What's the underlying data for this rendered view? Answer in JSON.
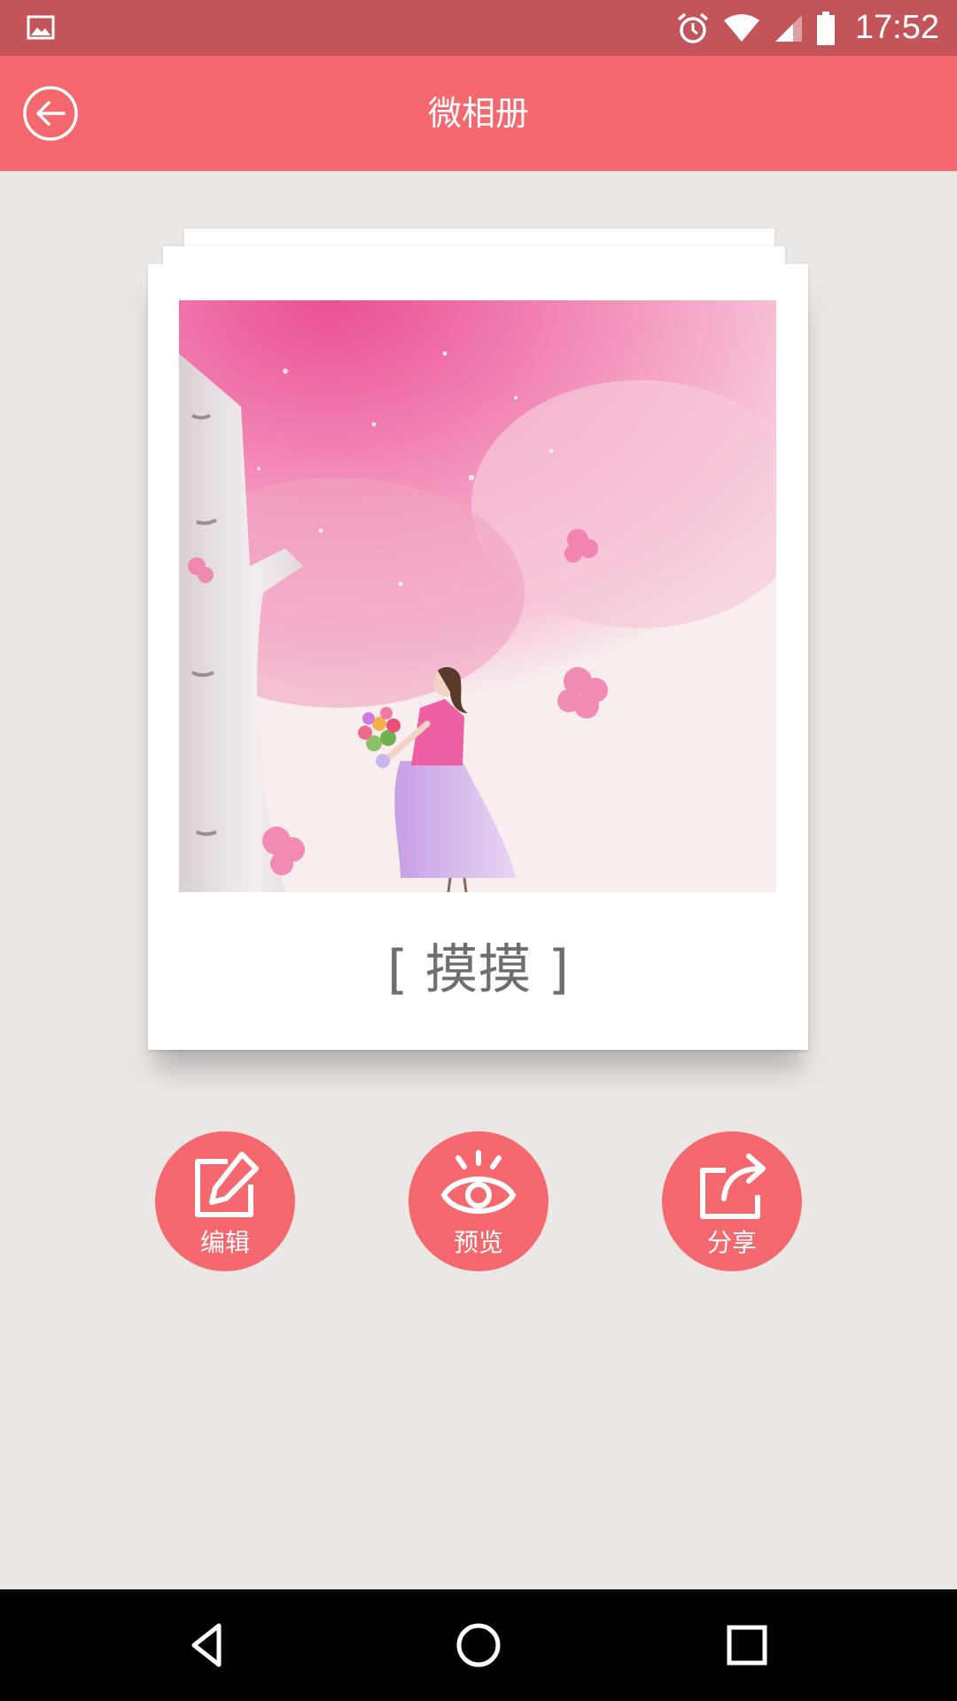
{
  "status_bar": {
    "time": "17:52",
    "icons": [
      "gallery-icon",
      "alarm-icon",
      "wifi-icon",
      "signal-icon",
      "battery-icon"
    ]
  },
  "app_bar": {
    "title": "微相册",
    "back_icon": "back-arrow-icon"
  },
  "album": {
    "caption": "[ 摸摸 ]",
    "cover_image": "pink-blossom-tree-girl-illustration"
  },
  "actions": [
    {
      "label": "编辑",
      "icon": "edit-icon"
    },
    {
      "label": "预览",
      "icon": "eye-icon"
    },
    {
      "label": "分享",
      "icon": "share-icon"
    }
  ],
  "nav_bar": {
    "icons": [
      "nav-back-icon",
      "nav-home-icon",
      "nav-recents-icon"
    ]
  },
  "colors": {
    "status_bar": "#c2545a",
    "accent": "#f4686e",
    "background": "#ebe7e5",
    "caption_text": "#6e6e6e"
  }
}
